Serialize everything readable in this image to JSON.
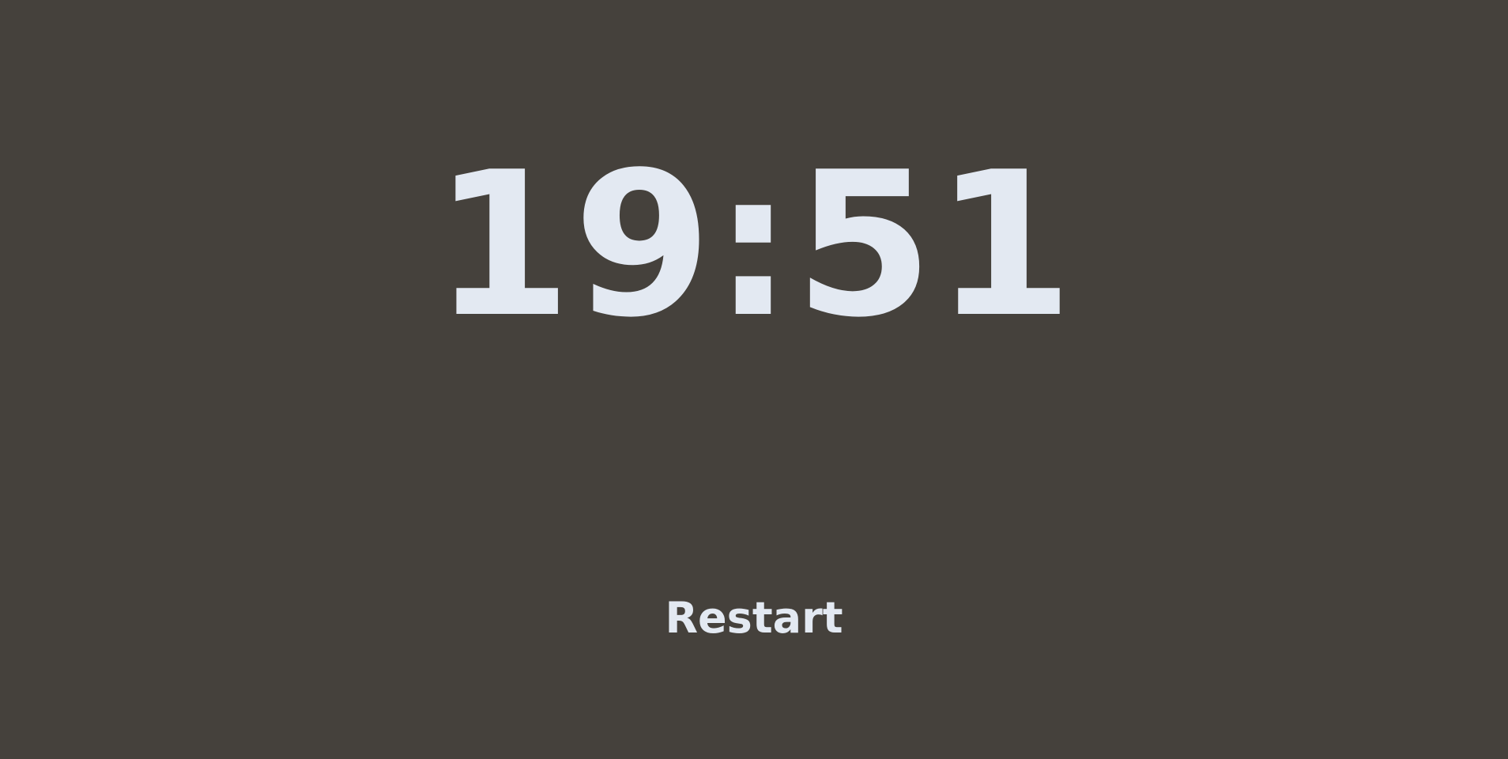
{
  "timer": {
    "display": "19:51"
  },
  "controls": {
    "restart_label": "Restart"
  },
  "colors": {
    "background": "#45413c",
    "foreground": "#e3e9f2"
  }
}
